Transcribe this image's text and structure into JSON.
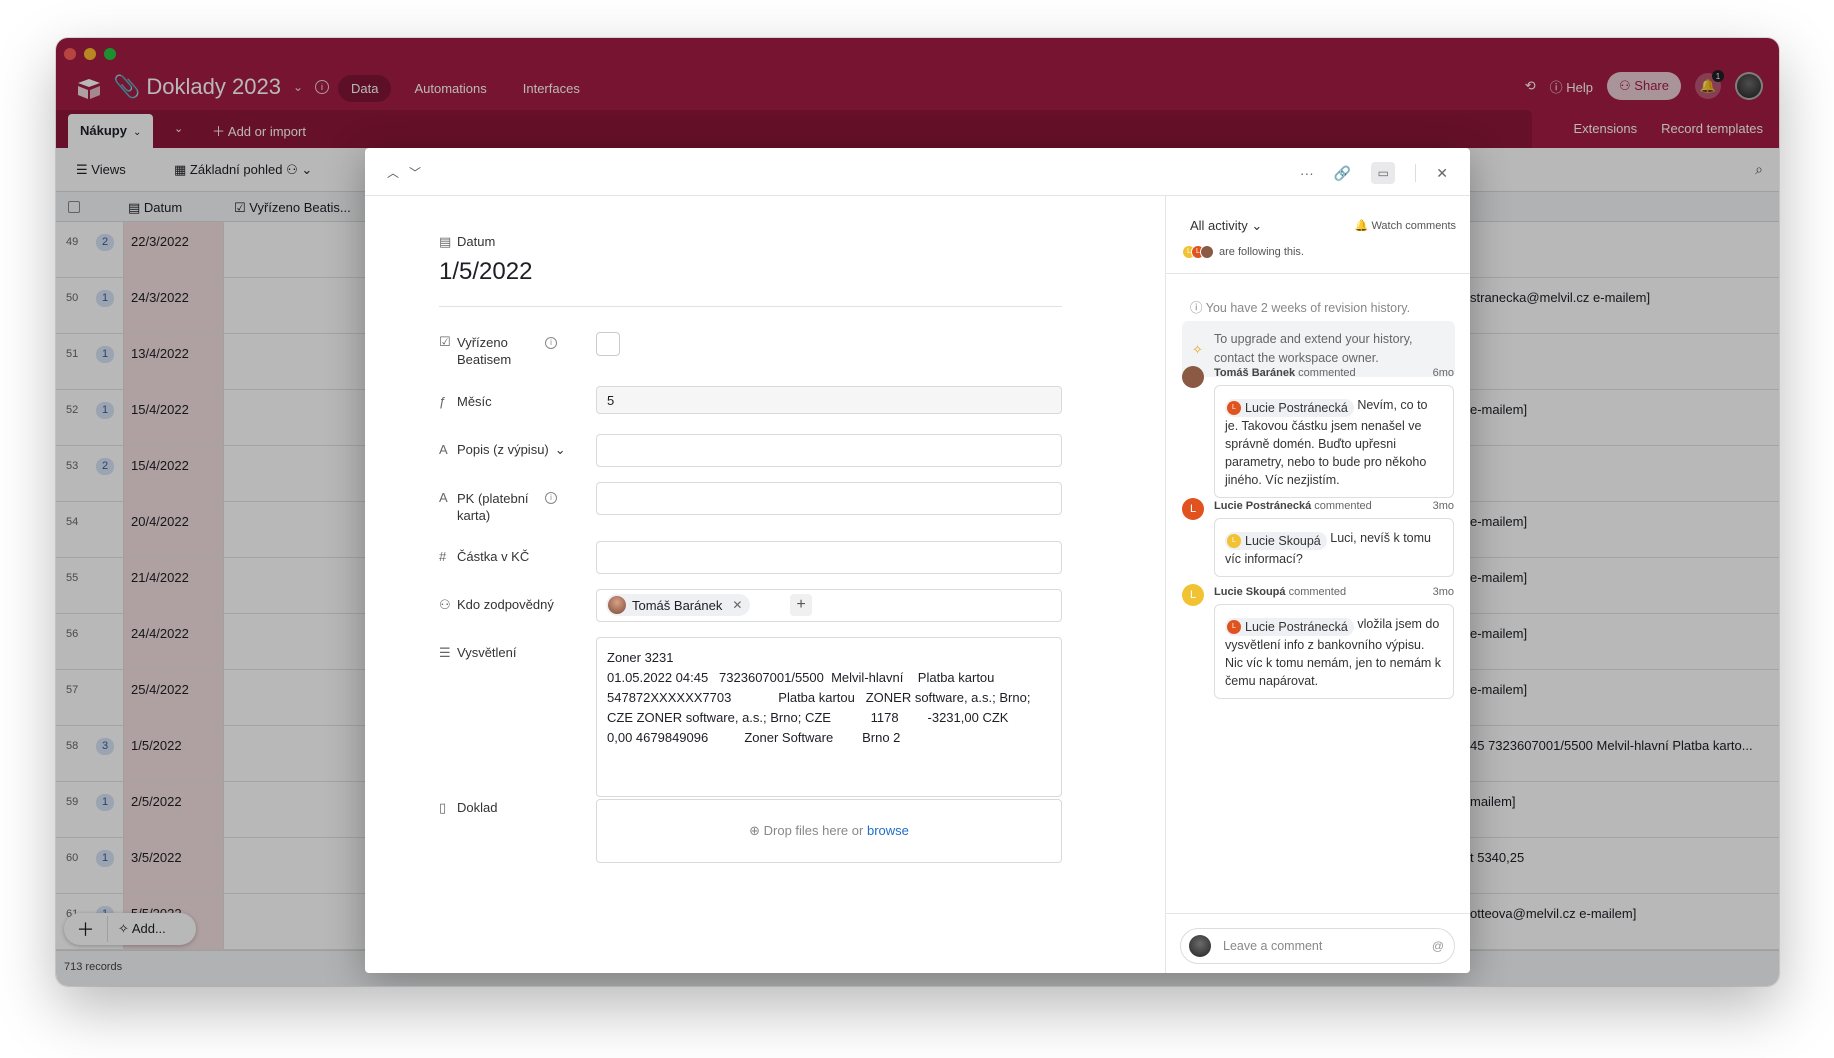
{
  "app": {
    "base_title": "Doklady 2023",
    "nav_tabs": [
      "Data",
      "Automations",
      "Interfaces"
    ],
    "help": "Help",
    "share": "Share",
    "notifications_count": "1"
  },
  "tablebar": {
    "table_name": "Nákupy",
    "add_import": "Add or import",
    "extensions": "Extensions",
    "record_templates": "Record templates"
  },
  "viewbar": {
    "views": "Views",
    "view_name": "Základní pohled"
  },
  "grid": {
    "headers": {
      "datum": "Datum",
      "vyrizeno": "Vyřízeno Beatis..."
    },
    "rows": [
      {
        "num": "49",
        "cnt": "2",
        "date": "22/3/2022",
        "right": ""
      },
      {
        "num": "50",
        "cnt": "1",
        "date": "24/3/2022",
        "right": "stranecka@melvil.cz e-mailem]"
      },
      {
        "num": "51",
        "cnt": "1",
        "date": "13/4/2022",
        "right": ""
      },
      {
        "num": "52",
        "cnt": "1",
        "date": "15/4/2022",
        "right": "e-mailem]"
      },
      {
        "num": "53",
        "cnt": "2",
        "date": "15/4/2022",
        "right": ""
      },
      {
        "num": "54",
        "cnt": "",
        "date": "20/4/2022",
        "right": "e-mailem]"
      },
      {
        "num": "55",
        "cnt": "",
        "date": "21/4/2022",
        "right": "e-mailem]"
      },
      {
        "num": "56",
        "cnt": "",
        "date": "24/4/2022",
        "right": "e-mailem]"
      },
      {
        "num": "57",
        "cnt": "",
        "date": "25/4/2022",
        "right": "e-mailem]"
      },
      {
        "num": "58",
        "cnt": "3",
        "date": "1/5/2022",
        "right": "45   7323607001/5500 Melvil-hlavní   Platba karto..."
      },
      {
        "num": "59",
        "cnt": "1",
        "date": "2/5/2022",
        "right": "mailem]"
      },
      {
        "num": "60",
        "cnt": "1",
        "date": "3/5/2022",
        "right": "t 5340,25"
      },
      {
        "num": "61",
        "cnt": "1",
        "date": "5/5/2022",
        "right": "otteova@melvil.cz e-mailem]"
      }
    ],
    "add_label": "Add...",
    "records": "713 records"
  },
  "record": {
    "datum_label": "Datum",
    "datum_value": "1/5/2022",
    "vyrizeno_label_1": "Vyřízeno",
    "vyrizeno_label_2": "Beatisem",
    "mesic_label": "Měsíc",
    "mesic_value": "5",
    "popis_label": "Popis (z výpisu)",
    "pk_label_1": "PK (platební",
    "pk_label_2": "karta)",
    "castka_label": "Částka v KČ",
    "kdo_label": "Kdo zodpovědný",
    "kdo_value": "Tomáš Baránek",
    "vysvetleni_label": "Vysvětlení",
    "vysvetleni_lines": [
      "Zoner 3231",
      "01.05.2022 04:45   7323607001/5500  Melvil-hlavní    Platba kartou",
      "547872XXXXXX7703             Platba kartou   ZONER software, a.s.; Brno;",
      "CZE ZONER software, a.s.; Brno; CZE           1178        -3231,00 CZK",
      "0,00 4679849096          Zoner Software        Brno 2"
    ],
    "doklad_label": "Doklad",
    "drop_text": "Drop files here or",
    "browse": "browse"
  },
  "activity": {
    "filter": "All activity",
    "watch": "Watch comments",
    "following": "are following this.",
    "revision": "You have 2 weeks of revision history.",
    "upgrade_1": "To upgrade and extend your history,",
    "upgrade_2": "contact the workspace owner.",
    "comments": [
      {
        "author": "Tomáš Baránek",
        "verb": "commented",
        "time": "6mo",
        "mention": "Lucie Postránecká",
        "text": "Nevím, co to je. Takovou částku jsem nenašel ve správně domén. Buďto upřesni parametry, nebo to bude pro někoho jiného. Víc nezjistím."
      },
      {
        "author": "Lucie Postránecká",
        "verb": "commented",
        "time": "3mo",
        "mention": "Lucie Skoupá",
        "text": "Luci, nevíš k tomu víc informací?"
      },
      {
        "author": "Lucie Skoupá",
        "verb": "commented",
        "time": "3mo",
        "mention": "Lucie Postránecká",
        "text": "vložila jsem do vysvětlení info z bankovního výpisu. Nic víc k tomu nemám, jen to nemám k čemu napárovat."
      }
    ],
    "leave_comment": "Leave a comment",
    "avatar_letter": "L",
    "colors": {
      "tomas": "#8a5a44",
      "postranecka": "#e0531f",
      "skoupa": "#f1c232"
    }
  }
}
